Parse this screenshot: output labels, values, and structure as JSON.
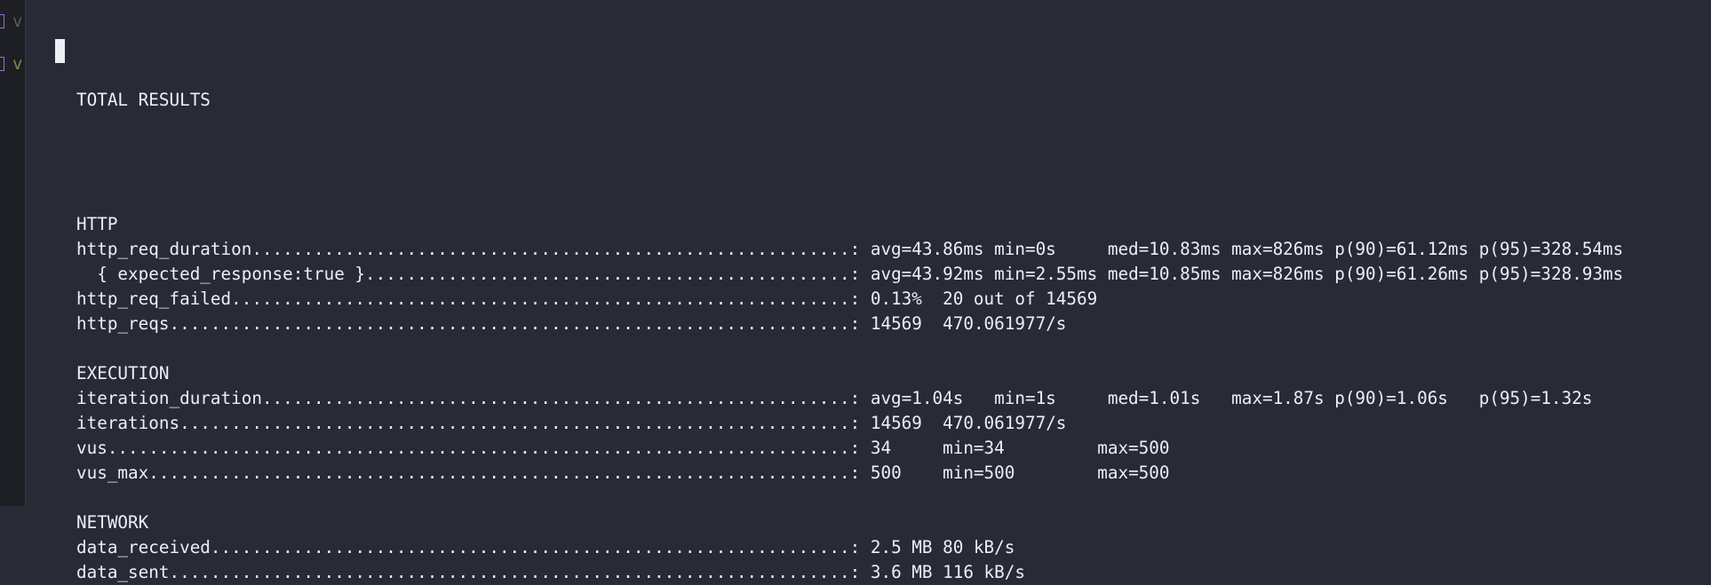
{
  "title": "TOTAL RESULTS",
  "sections": [
    {
      "heading": "HTTP",
      "metrics": [
        {
          "name": "http_req_duration",
          "values": "avg=43.86ms min=0s     med=10.83ms max=826ms p(90)=61.12ms p(95)=328.54ms"
        },
        {
          "name": "  { expected_response:true }",
          "values": "avg=43.92ms min=2.55ms med=10.85ms max=826ms p(90)=61.26ms p(95)=328.93ms"
        },
        {
          "name": "http_req_failed",
          "values": "0.13%  20 out of 14569"
        },
        {
          "name": "http_reqs",
          "values": "14569  470.061977/s"
        }
      ]
    },
    {
      "heading": "EXECUTION",
      "metrics": [
        {
          "name": "iteration_duration",
          "values": "avg=1.04s   min=1s     med=1.01s   max=1.87s p(90)=1.06s   p(95)=1.32s"
        },
        {
          "name": "iterations",
          "values": "14569  470.061977/s"
        },
        {
          "name": "vus",
          "values": "34     min=34         max=500"
        },
        {
          "name": "vus_max",
          "values": "500    min=500        max=500"
        }
      ]
    },
    {
      "heading": "NETWORK",
      "metrics": [
        {
          "name": "data_received",
          "values": "2.5 MB 80 kB/s"
        },
        {
          "name": "data_sent",
          "values": "3.6 MB 116 kB/s"
        }
      ]
    }
  ],
  "gutter": [
    "v",
    "v"
  ]
}
